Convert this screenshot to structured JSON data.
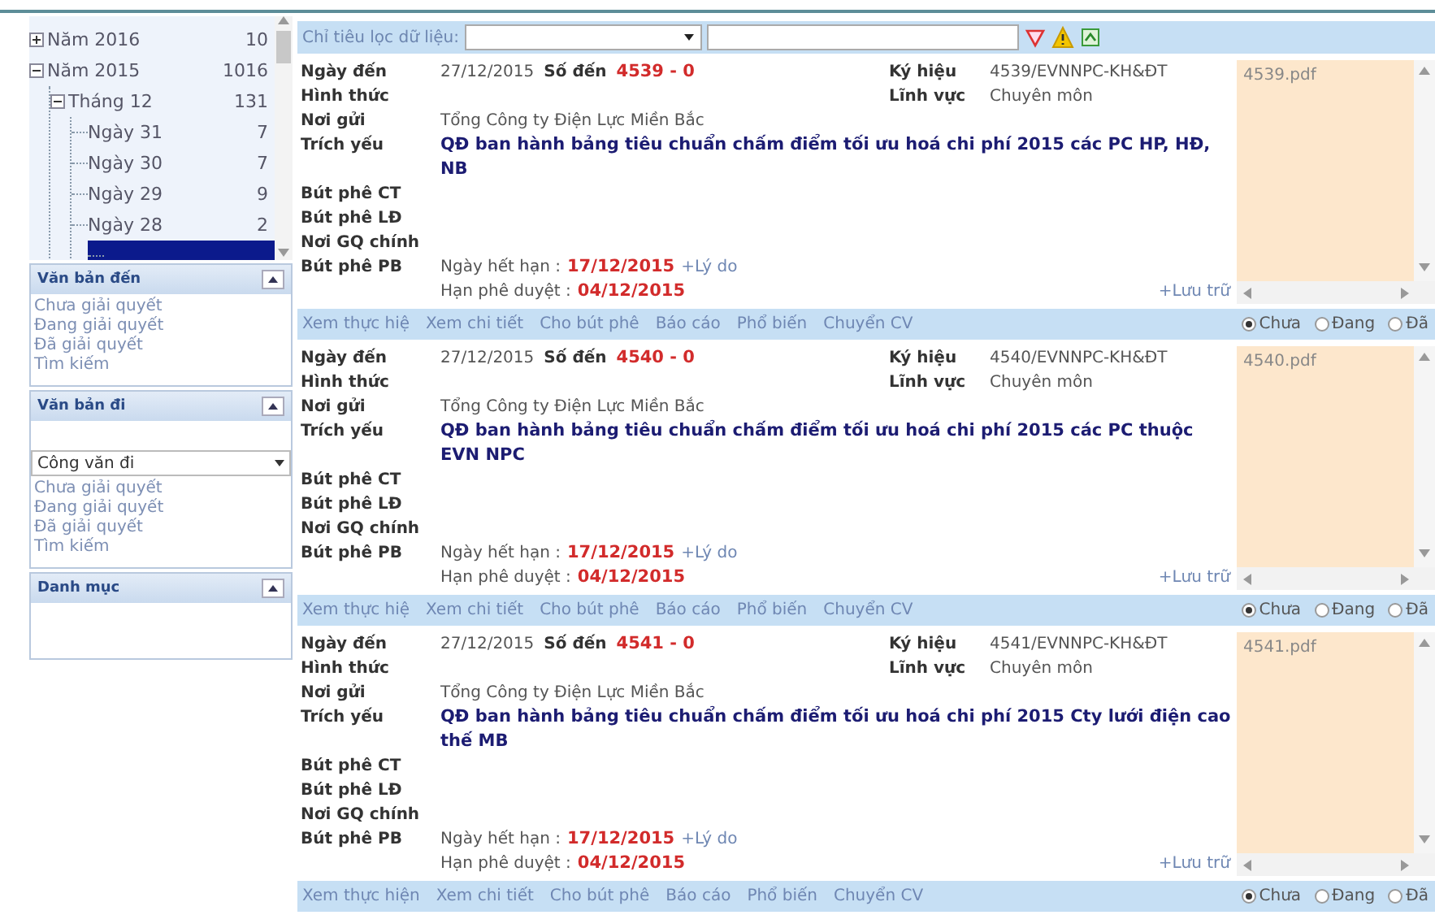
{
  "tree": [
    {
      "label": "Năm 2016",
      "count": "10",
      "expanded": false,
      "selected": false
    },
    {
      "label": "Năm 2015",
      "count": "1016",
      "expanded": true,
      "selected": false,
      "children": [
        {
          "label": "Tháng 12",
          "count": "131",
          "expanded": true,
          "selected": false,
          "children": [
            {
              "label": "Ngày 31",
              "count": "7",
              "selected": false
            },
            {
              "label": "Ngày 30",
              "count": "7",
              "selected": false
            },
            {
              "label": "Ngày 29",
              "count": "9",
              "selected": false
            },
            {
              "label": "Ngày 28",
              "count": "2",
              "selected": false
            },
            {
              "selected": true
            }
          ]
        }
      ]
    }
  ],
  "panels": [
    {
      "title": "Văn bản đến",
      "links": [
        "Chưa giải quyết",
        "Đang giải quyết",
        "Đã giải quyết",
        "Tìm kiếm"
      ]
    },
    {
      "title": "Văn bản đi",
      "select": "Công văn đi",
      "links": [
        "Chưa giải quyết",
        "Đang giải quyết",
        "Đã giải quyết",
        "Tìm kiếm"
      ]
    },
    {
      "title": "Danh mục"
    }
  ],
  "filter": {
    "label": "Chỉ tiêu lọc dữ liệu:"
  },
  "records": [
    {
      "labels": [
        "Ngày đến",
        "Hình thức",
        "Nơi gửi",
        "Trích yếu",
        "Bút phê CT",
        "Bút phê LĐ",
        "Nơi GQ chính",
        "Bút phê PB"
      ],
      "date": "27/12/2015",
      "so_den_label": "Số đến",
      "so_den": "4539 - 0",
      "ky_hieu_label": "Ký hiệu",
      "ky_hieu": "4539/EVNNPC-KH&ĐT",
      "linh_vuc_label": "Lĩnh vực",
      "linh_vuc": "Chuyên môn",
      "noi_gui": "Tổng Công ty Điện Lực Miền Bắc",
      "trich_yeu": "QĐ ban hành bảng tiêu chuẩn chấm điểm tối ưu hoá chi phí 2015 các PC HP, HĐ, NB",
      "han_label": "Ngày hết hạn :",
      "han": "17/12/2015",
      "ly_do": "+Lý do",
      "phe_duyet_label": "Hạn phê duyệt :",
      "phe_duyet": "04/12/2015",
      "luu_tru": "+Lưu trữ",
      "attachment": "4539.pdf",
      "actions": [
        "Xem thực hiệ",
        "Xem chi tiết",
        "Cho bút phê",
        "Báo cáo",
        "Phổ biến",
        "Chuyển CV"
      ],
      "status": [
        {
          "label": "Chưa",
          "selected": true
        },
        {
          "label": "Đang",
          "selected": false
        },
        {
          "label": "Đã",
          "selected": false
        }
      ]
    },
    {
      "labels": [
        "Ngày đến",
        "Hình thức",
        "Nơi gửi",
        "Trích yếu",
        "Bút phê CT",
        "Bút phê LĐ",
        "Nơi GQ chính",
        "Bút phê PB"
      ],
      "date": "27/12/2015",
      "so_den_label": "Số đến",
      "so_den": "4540 - 0",
      "ky_hieu_label": "Ký hiệu",
      "ky_hieu": "4540/EVNNPC-KH&ĐT",
      "linh_vuc_label": "Lĩnh vực",
      "linh_vuc": "Chuyên môn",
      "noi_gui": "Tổng Công ty Điện Lực Miền Bắc",
      "trich_yeu": "QĐ ban hành bảng tiêu chuẩn chấm điểm tối ưu hoá chi phí 2015 các PC thuộc EVN NPC",
      "han_label": "Ngày hết hạn :",
      "han": "17/12/2015",
      "ly_do": "+Lý do",
      "phe_duyet_label": "Hạn phê duyệt :",
      "phe_duyet": "04/12/2015",
      "luu_tru": "+Lưu trữ",
      "attachment": "4540.pdf",
      "actions": [
        "Xem thực hiệ",
        "Xem chi tiết",
        "Cho bút phê",
        "Báo cáo",
        "Phổ biến",
        "Chuyển CV"
      ],
      "status": [
        {
          "label": "Chưa",
          "selected": true
        },
        {
          "label": "Đang",
          "selected": false
        },
        {
          "label": "Đã",
          "selected": false
        }
      ]
    },
    {
      "labels": [
        "Ngày đến",
        "Hình thức",
        "Nơi gửi",
        "Trích yếu",
        "Bút phê CT",
        "Bút phê LĐ",
        "Nơi GQ chính",
        "Bút phê PB"
      ],
      "date": "27/12/2015",
      "so_den_label": "Số đến",
      "so_den": "4541 - 0",
      "ky_hieu_label": "Ký hiệu",
      "ky_hieu": "4541/EVNNPC-KH&ĐT",
      "linh_vuc_label": "Lĩnh vực",
      "linh_vuc": "Chuyên môn",
      "noi_gui": "Tổng Công ty Điện Lực Miền Bắc",
      "trich_yeu": "QĐ ban hành bảng tiêu chuẩn chấm điểm tối ưu hoá chi phí 2015 Cty lưới điện cao thế MB",
      "han_label": "Ngày hết hạn :",
      "han": "17/12/2015",
      "ly_do": "+Lý do",
      "phe_duyet_label": "Hạn phê duyệt :",
      "phe_duyet": "04/12/2015",
      "luu_tru": "+Lưu trữ",
      "attachment": "4541.pdf",
      "actions": [
        "Xem thực hiện",
        "Xem chi tiết",
        "Cho bút phê",
        "Báo cáo",
        "Phổ biến",
        "Chuyển CV"
      ],
      "status": [
        {
          "label": "Chưa",
          "selected": true
        },
        {
          "label": "Đang",
          "selected": false
        },
        {
          "label": "Đã",
          "selected": false
        }
      ]
    }
  ]
}
